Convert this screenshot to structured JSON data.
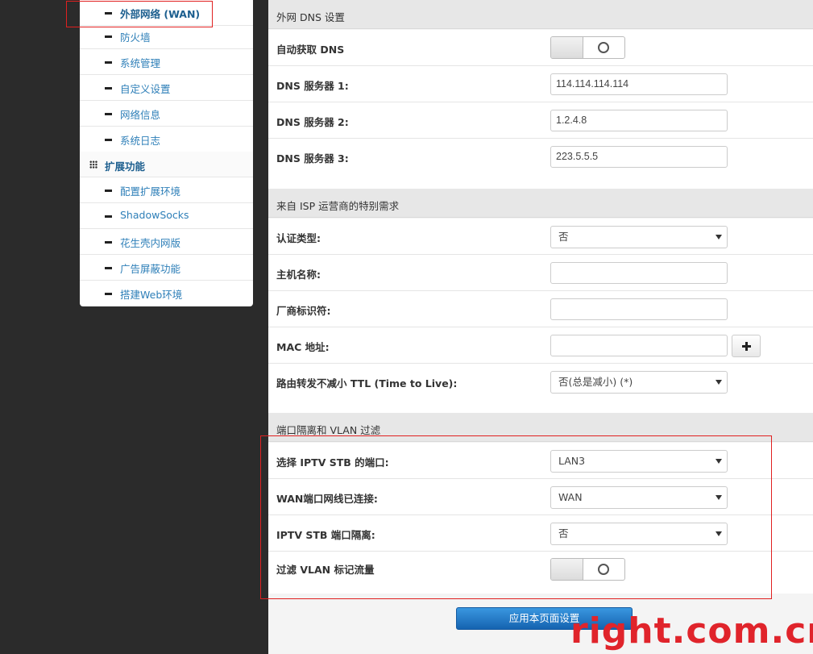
{
  "sidebar": {
    "items": [
      {
        "label": "外部网络 (WAN)"
      },
      {
        "label": "防火墙"
      },
      {
        "label": "系统管理"
      },
      {
        "label": "自定义设置"
      },
      {
        "label": "网络信息"
      },
      {
        "label": "系统日志"
      }
    ],
    "group": {
      "label": "扩展功能"
    },
    "ext_items": [
      {
        "label": "配置扩展环境"
      },
      {
        "label": "ShadowSocks"
      },
      {
        "label": "花生壳内网版"
      },
      {
        "label": "广告屏蔽功能"
      },
      {
        "label": "搭建Web环境"
      }
    ]
  },
  "dns": {
    "title": "外网 DNS 设置",
    "auto_label": "自动获取 DNS",
    "dns1_label": "DNS 服务器 1:",
    "dns1_value": "114.114.114.114",
    "dns2_label": "DNS 服务器 2:",
    "dns2_value": "1.2.4.8",
    "dns3_label": "DNS 服务器 3:",
    "dns3_value": "223.5.5.5"
  },
  "isp": {
    "title": "来自 ISP 运营商的特别需求",
    "auth_label": "认证类型:",
    "auth_value": "否",
    "host_label": "主机名称:",
    "vendor_label": "厂商标识符:",
    "mac_label": "MAC 地址:",
    "ttl_label": "路由转发不减小 TTL (Time to Live):",
    "ttl_value": "否(总是减小) (*)"
  },
  "vlan": {
    "title": "端口隔离和 VLAN 过滤",
    "iptv_port_label": "选择 IPTV STB 的端口:",
    "iptv_port_value": "LAN3",
    "wan_port_label": "WAN端口网线已连接:",
    "wan_port_value": "WAN",
    "iptv_iso_label": "IPTV STB 端口隔离:",
    "iptv_iso_value": "否",
    "vlan_filter_label": "过滤 VLAN 标记流量"
  },
  "apply_label": "应用本页面设置",
  "watermark": "right.com.cn"
}
